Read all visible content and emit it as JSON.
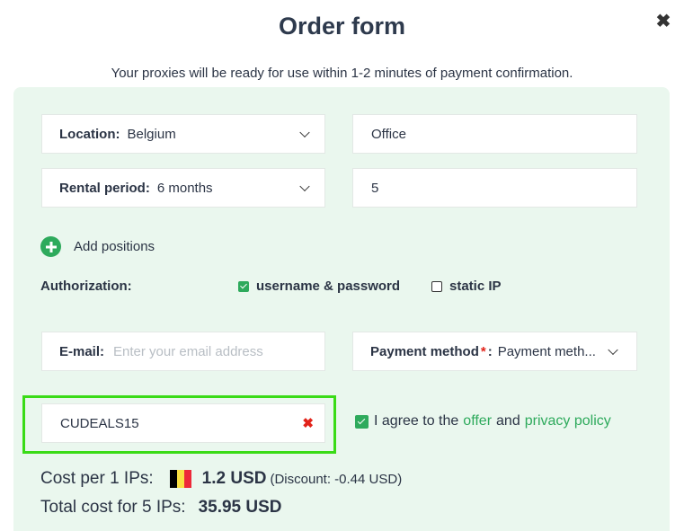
{
  "modal": {
    "title": "Order form",
    "subtitle": "Your proxies will be ready for use within 1-2 minutes of payment confirmation.",
    "close_icon": "✖"
  },
  "form": {
    "location": {
      "label": "Location:",
      "value": "Belgium"
    },
    "proxy_type": {
      "value": "Office"
    },
    "rental_period": {
      "label": "Rental period:",
      "value": "6 months"
    },
    "quantity": {
      "value": "5"
    },
    "add_positions_label": "Add positions",
    "authorization": {
      "label": "Authorization:",
      "options": [
        {
          "label": "username & password",
          "checked": true
        },
        {
          "label": "static IP",
          "checked": false
        }
      ]
    },
    "email": {
      "label": "E-mail:",
      "value": "",
      "placeholder": "Enter your email address"
    },
    "payment": {
      "label": "Payment method",
      "required_mark": "*",
      "colon": ":",
      "value": "Payment meth..."
    },
    "promo": {
      "value": "CUDEALS15",
      "clear_icon": "✖"
    },
    "agree": {
      "checked": true,
      "prefix": "I agree to the",
      "offer_link": "offer",
      "and": "and",
      "privacy_link": "privacy policy"
    }
  },
  "cost": {
    "per_label": "Cost per 1 IPs:",
    "per_price": "1.2 USD",
    "discount": "(Discount: -0.44 USD)",
    "total_label": "Total cost for 5 IPs:",
    "total_price": "35.95 USD"
  },
  "colors": {
    "accent": "#2eaa5c",
    "panel_bg": "#eaf7ee",
    "highlight": "#3adb17",
    "error": "#e2231a",
    "flag": [
      "#000000",
      "#fae042",
      "#ed2939"
    ]
  },
  "icons": {
    "close": "close-icon",
    "dropdown": "chevron-down-icon",
    "add": "plus-circle-icon",
    "clear": "clear-x-icon",
    "flag": "belgium-flag-icon"
  }
}
